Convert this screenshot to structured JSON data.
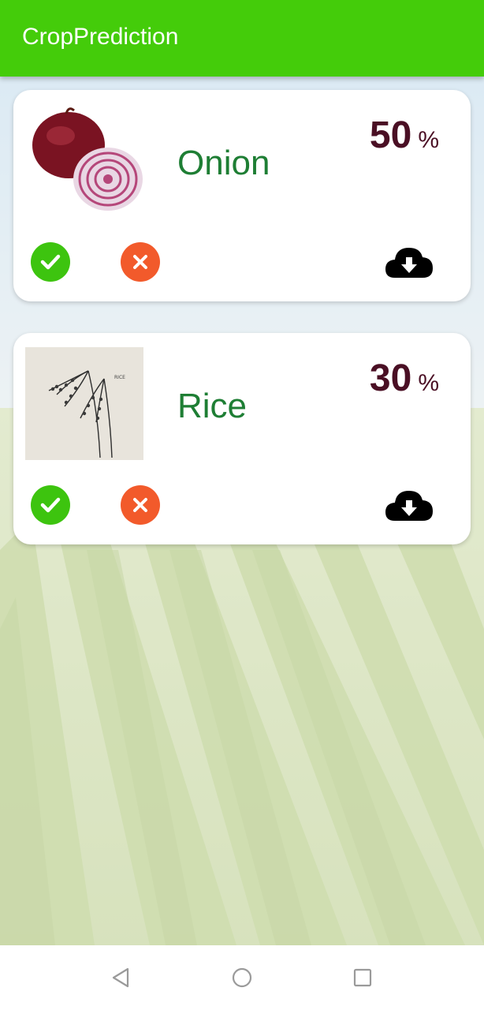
{
  "app_bar": {
    "title": "CropPrediction",
    "color": "#44cc0a"
  },
  "cards": [
    {
      "crop_name": "Onion",
      "percent_value": "50",
      "percent_sign": "%",
      "image_icon": "onion-image",
      "accept_icon": "check-icon",
      "reject_icon": "close-icon",
      "download_icon": "cloud-download-icon"
    },
    {
      "crop_name": "Rice",
      "percent_value": "30",
      "percent_sign": "%",
      "image_icon": "rice-sketch-image",
      "image_caption": "RICE",
      "accept_icon": "check-icon",
      "reject_icon": "close-icon",
      "download_icon": "cloud-download-icon"
    }
  ],
  "colors": {
    "crop_name": "#1e7e34",
    "percent": "#4a0f24",
    "accept": "#3dc40f",
    "reject": "#f25a2b"
  },
  "nav_bar": {
    "back_icon": "back-triangle-icon",
    "home_icon": "home-circle-icon",
    "recents_icon": "recents-square-icon"
  }
}
